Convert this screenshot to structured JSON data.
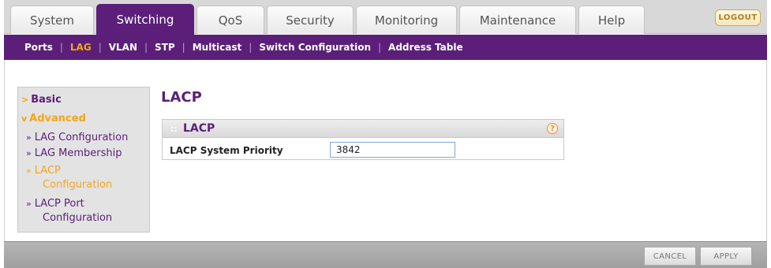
{
  "tabs": [
    {
      "label": "System"
    },
    {
      "label": "Switching"
    },
    {
      "label": "QoS"
    },
    {
      "label": "Security"
    },
    {
      "label": "Monitoring"
    },
    {
      "label": "Maintenance"
    },
    {
      "label": "Help"
    }
  ],
  "logout_label": "LOGOUT",
  "subnav": [
    {
      "label": "Ports"
    },
    {
      "label": "LAG"
    },
    {
      "label": "VLAN"
    },
    {
      "label": "STP"
    },
    {
      "label": "Multicast"
    },
    {
      "label": "Switch Configuration"
    },
    {
      "label": "Address Table"
    }
  ],
  "leftnav": {
    "basic": "Basic",
    "advanced": "Advanced",
    "basic_arrow": ">",
    "advanced_arrow": "v",
    "bullet": "»",
    "items": [
      {
        "line1": "LAG Configuration",
        "line2": ""
      },
      {
        "line1": "LAG Membership",
        "line2": ""
      },
      {
        "line1": "LACP",
        "line2": "Configuration"
      },
      {
        "line1": "LACP Port",
        "line2": "Configuration"
      }
    ]
  },
  "page_title": "LACP",
  "panel": {
    "title": "LACP",
    "grip": "::",
    "help": "?",
    "field_label": "LACP System Priority",
    "field_value": "3842"
  },
  "buttons": {
    "cancel": "CANCEL",
    "apply": "APPLY"
  },
  "colors": {
    "brand_purple": "#5b1f79",
    "accent_orange": "#f3a51c"
  }
}
